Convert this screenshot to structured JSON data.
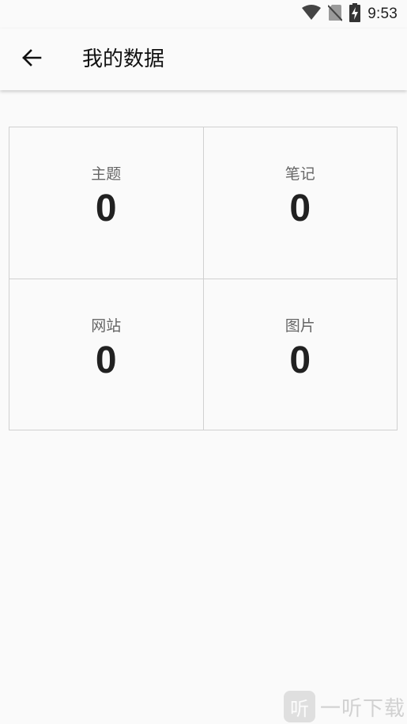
{
  "status_bar": {
    "time": "9:53",
    "icons": [
      "wifi-icon",
      "no-sim-icon",
      "battery-charging-icon"
    ]
  },
  "app_bar": {
    "title": "我的数据",
    "back_icon": "arrow-left-icon"
  },
  "stats": [
    {
      "label": "主题",
      "value": "0"
    },
    {
      "label": "笔记",
      "value": "0"
    },
    {
      "label": "网站",
      "value": "0"
    },
    {
      "label": "图片",
      "value": "0"
    }
  ],
  "watermark": {
    "badge": "听",
    "text": "一听下载"
  },
  "colors": {
    "background": "#fafafa",
    "text_primary": "#212121",
    "text_secondary": "#666666",
    "divider": "#d0d0d0"
  }
}
